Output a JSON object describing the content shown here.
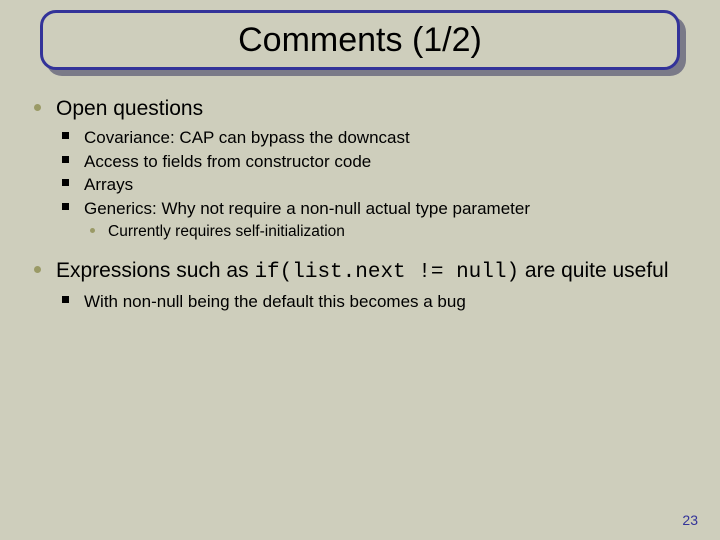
{
  "title": "Comments (1/2)",
  "bullets": {
    "b1": "Open questions",
    "b1_1": "Covariance: CAP can bypass the downcast",
    "b1_2": "Access to fields from constructor code",
    "b1_3": "Arrays",
    "b1_4": "Generics: Why not require a non-null actual type parameter",
    "b1_4_1": "Currently requires self-initialization",
    "b2_pre": "Expressions such as ",
    "b2_code": "if(list.next != null)",
    "b2_post": " are quite useful",
    "b2_1": "With non-null being the default this becomes a bug"
  },
  "page_number": "23"
}
